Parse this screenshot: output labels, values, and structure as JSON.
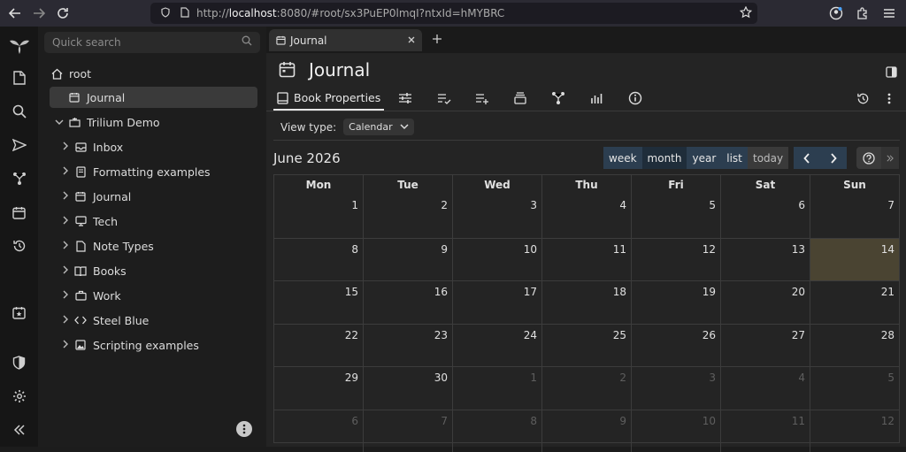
{
  "browser": {
    "url_prefix": "http://",
    "url_host": "localhost",
    "url_rest": ":8080/#root/sx3PuEP0lmqI?ntxId=hMYBRC"
  },
  "search": {
    "placeholder": "Quick search"
  },
  "tree": {
    "root_label": "root",
    "journal_label": "Journal",
    "demo_label": "Trilium Demo",
    "children": [
      "Inbox",
      "Formatting examples",
      "Journal",
      "Tech",
      "Note Types",
      "Books",
      "Work",
      "Steel Blue",
      "Scripting examples"
    ]
  },
  "tab": {
    "label": "Journal"
  },
  "note": {
    "title": "Journal"
  },
  "toolbar": {
    "book_properties": "Book Properties"
  },
  "view_type": {
    "label": "View type:",
    "value": "Calendar"
  },
  "calendar": {
    "month_title": "June 2026",
    "views": [
      "week",
      "month",
      "year",
      "list"
    ],
    "today_label": "today",
    "weekdays": [
      "Mon",
      "Tue",
      "Wed",
      "Thu",
      "Fri",
      "Sat",
      "Sun"
    ],
    "weeks": [
      [
        {
          "d": "1"
        },
        {
          "d": "2"
        },
        {
          "d": "3"
        },
        {
          "d": "4"
        },
        {
          "d": "5"
        },
        {
          "d": "6"
        },
        {
          "d": "7"
        }
      ],
      [
        {
          "d": "8"
        },
        {
          "d": "9"
        },
        {
          "d": "10"
        },
        {
          "d": "11"
        },
        {
          "d": "12"
        },
        {
          "d": "13"
        },
        {
          "d": "14",
          "today": true
        }
      ],
      [
        {
          "d": "15"
        },
        {
          "d": "16"
        },
        {
          "d": "17"
        },
        {
          "d": "18"
        },
        {
          "d": "19"
        },
        {
          "d": "20"
        },
        {
          "d": "21"
        }
      ],
      [
        {
          "d": "22"
        },
        {
          "d": "23"
        },
        {
          "d": "24"
        },
        {
          "d": "25"
        },
        {
          "d": "26"
        },
        {
          "d": "27"
        },
        {
          "d": "28"
        }
      ],
      [
        {
          "d": "29"
        },
        {
          "d": "30"
        },
        {
          "d": "1",
          "other": true
        },
        {
          "d": "2",
          "other": true
        },
        {
          "d": "3",
          "other": true
        },
        {
          "d": "4",
          "other": true
        },
        {
          "d": "5",
          "other": true
        }
      ],
      [
        {
          "d": "6",
          "other": true
        },
        {
          "d": "7",
          "other": true
        },
        {
          "d": "8",
          "other": true
        },
        {
          "d": "9",
          "other": true
        },
        {
          "d": "10",
          "other": true
        },
        {
          "d": "11",
          "other": true
        },
        {
          "d": "12",
          "other": true
        }
      ]
    ]
  },
  "colors": {
    "accent_button": "#2c3e50",
    "today_cell": "#4a4432"
  }
}
